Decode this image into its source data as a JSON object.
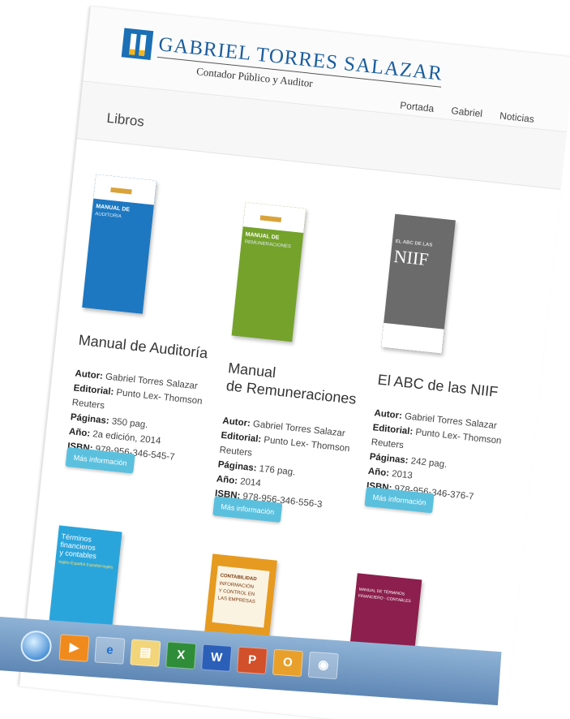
{
  "header": {
    "brand_name": "GABRIEL TORRES SALAZAR",
    "brand_subtitle": "Contador Público y Auditor",
    "nav": [
      "Portada",
      "Gabriel",
      "Noticias"
    ]
  },
  "page_title": "Libros",
  "books": [
    {
      "title_lines": [
        "Manual de Auditoría"
      ],
      "cover_text": [
        "MANUAL DE",
        "AUDITORIA"
      ],
      "cover_color": "#1d78c1",
      "autor": "Gabriel Torres Salazar",
      "editorial_lines": [
        "Punto Lex- Thomson",
        "Reuters"
      ],
      "paginas": "350 pag.",
      "anio": "2a edición, 2014",
      "isbn": "978-956-346-545-7"
    },
    {
      "title_lines": [
        "Manual",
        "de Remuneraciones"
      ],
      "cover_text": [
        "MANUAL DE",
        "REMUNERACIONES"
      ],
      "cover_color": "#74a22b",
      "autor": "Gabriel Torres Salazar",
      "editorial_lines": [
        "Punto Lex- Thomson",
        "Reuters"
      ],
      "paginas": "176 pag.",
      "anio": "2014",
      "isbn": "978-956-346-556-3"
    },
    {
      "title_lines": [
        "El ABC de las NIIF"
      ],
      "cover_text": [
        "EL ABC DE LAS",
        "NIIF"
      ],
      "cover_color": "#6b6b6b",
      "autor": "Gabriel Torres Salazar",
      "editorial_lines": [
        "Punto Lex- Thomson",
        "Reuters"
      ],
      "paginas": "242 pag.",
      "anio": "2013",
      "isbn": "978-956-346-376-7"
    }
  ],
  "labels": {
    "autor": "Autor:",
    "editorial": "Editorial:",
    "paginas": "Páginas:",
    "anio": "Año:",
    "isbn": "ISBN:",
    "more_button": "Más información"
  },
  "more_books": [
    {
      "cover_text": [
        "Términos",
        "financieros",
        "y contables"
      ],
      "cover_text2": "Inglés-Español Español-Inglés",
      "cover_color": "#2aa5dc"
    },
    {
      "cover_text": [
        "CONTABILIDAD",
        "INFORMACIÓN",
        "Y CONTROL EN",
        "LAS EMPRESAS"
      ],
      "cover_color": "#e69a1f"
    },
    {
      "cover_text": [
        "MANUAL DE TÉRMINOS",
        "FINANCIERO - CONTABLES"
      ],
      "cover_color": "#8c1f4d"
    }
  ],
  "taskbar": {
    "items": [
      "media-player-icon",
      "internet-explorer-icon",
      "file-explorer-icon",
      "excel-icon",
      "word-icon",
      "powerpoint-icon",
      "outlook-icon",
      "chrome-icon"
    ]
  }
}
